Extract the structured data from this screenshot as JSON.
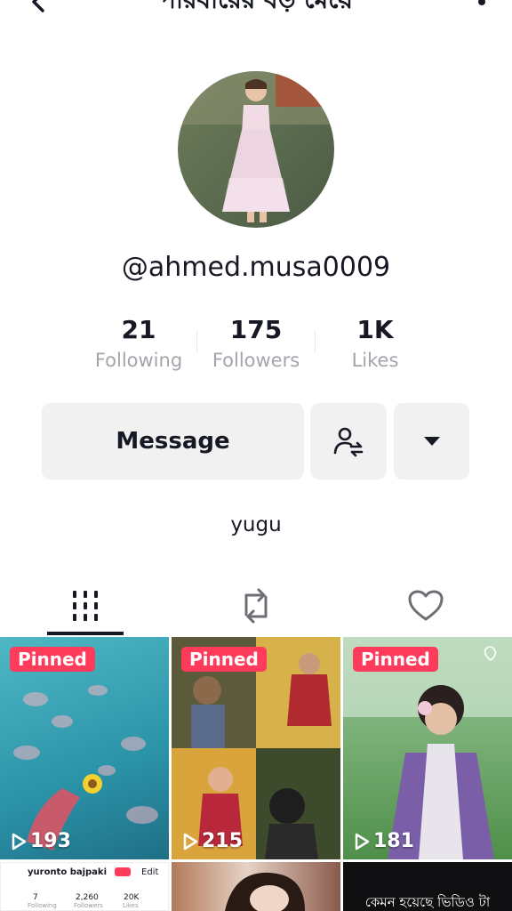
{
  "header": {
    "title": "পরিবারের বড় মেয়ে",
    "back_icon": "back-arrow-icon",
    "more_icon": "more-dots-icon"
  },
  "profile": {
    "handle": "@ahmed.musa0009",
    "bio": "yugu"
  },
  "stats": [
    {
      "num": "21",
      "label": "Following"
    },
    {
      "num": "175",
      "label": "Followers"
    },
    {
      "num": "1K",
      "label": "Likes"
    }
  ],
  "actions": {
    "message_label": "Message",
    "friend_icon": "add-friend-icon",
    "dropdown_icon": "caret-down-icon"
  },
  "tabs": [
    {
      "name": "videos",
      "icon": "grid-icon"
    },
    {
      "name": "reposts",
      "icon": "repost-icon"
    },
    {
      "name": "liked",
      "icon": "heart-icon"
    }
  ],
  "videos": [
    {
      "pinned": "Pinned",
      "views": "193"
    },
    {
      "pinned": "Pinned",
      "views": "215"
    },
    {
      "pinned": "Pinned",
      "views": "181"
    }
  ],
  "bottom_row": {
    "profile_name": "yuronto bajpaki",
    "edit": "Edit",
    "s1_num": "7",
    "s1_lbl": "Following",
    "s2_num": "2,260",
    "s2_lbl": "Followers",
    "s3_num": "20K",
    "s3_lbl": "Likes",
    "caption": "কেমন হয়েছে ভিডিও টা"
  },
  "colors": {
    "pinned": "#ff3b5c",
    "button_bg": "#f1f1f2",
    "secondary_text": "#a3a5ab"
  }
}
